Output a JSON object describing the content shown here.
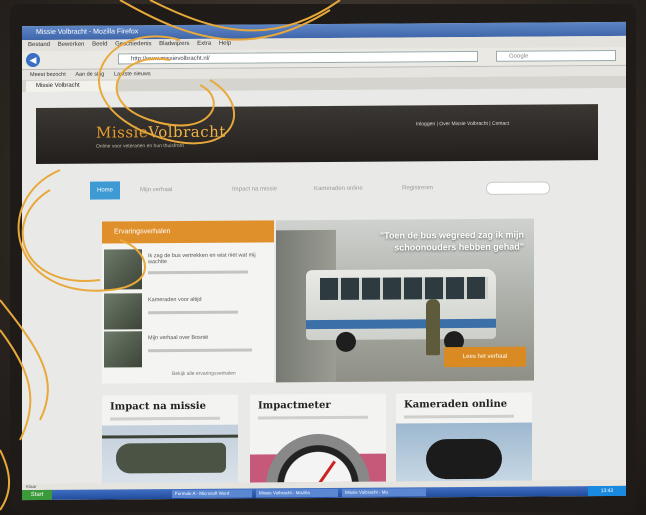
{
  "browser": {
    "window_title": "Missie Volbracht - Mozilla Firefox",
    "menu": [
      "Bestand",
      "Bewerken",
      "Beeld",
      "Geschiedenis",
      "Bladwijzers",
      "Extra",
      "Help"
    ],
    "address": "http://www.missievolbracht.nl/",
    "search_placeholder": "Google",
    "bookmarks": [
      "Meest bezocht",
      "Aan de slag",
      "Laatste nieuws"
    ],
    "tab_label": "Missie Volbracht",
    "back_icon": "back-arrow-icon",
    "status": "Klaar"
  },
  "site": {
    "logo_part1": "Missie",
    "logo_part2": "Volbracht",
    "tagline": "Online voor veteranen en hun thuisfront",
    "top_links": "Inloggen | Over Missie Volbracht | Contact",
    "nav": [
      "Home",
      "Mijn verhaal",
      "Impact na missie",
      "Kameraden online",
      "Registreren"
    ],
    "sidebar": {
      "heading": "Ervaringsverhalen",
      "items": [
        {
          "title": "Ik zag de bus vertrekken en wist niet wat mij wachtte"
        },
        {
          "title": "Kameraden voor altijd"
        },
        {
          "title": "Mijn verhaal over Bosnië"
        }
      ],
      "more": "Bekijk alle ervaringsverhalen"
    },
    "hero": {
      "quote": "\"Toen de bus wegreed zag ik mijn schoonouders hebben gehad\"",
      "button": "Lees het verhaal"
    },
    "cards": [
      {
        "title": "Impact na missie"
      },
      {
        "title": "Impactmeter"
      },
      {
        "title": "Kameraden online"
      }
    ]
  },
  "taskbar": {
    "start": "Start",
    "tasks": [
      "Formule A - Microsoft Word",
      "Missie Volbracht - Mozilla",
      "Missie Volbracht - Mo"
    ],
    "clock": "13:42"
  },
  "colors": {
    "accent": "#e0902a",
    "nav_active": "#3d9ad3",
    "header_bg": "#2b2724",
    "overlay_line": "#e8a83a"
  }
}
